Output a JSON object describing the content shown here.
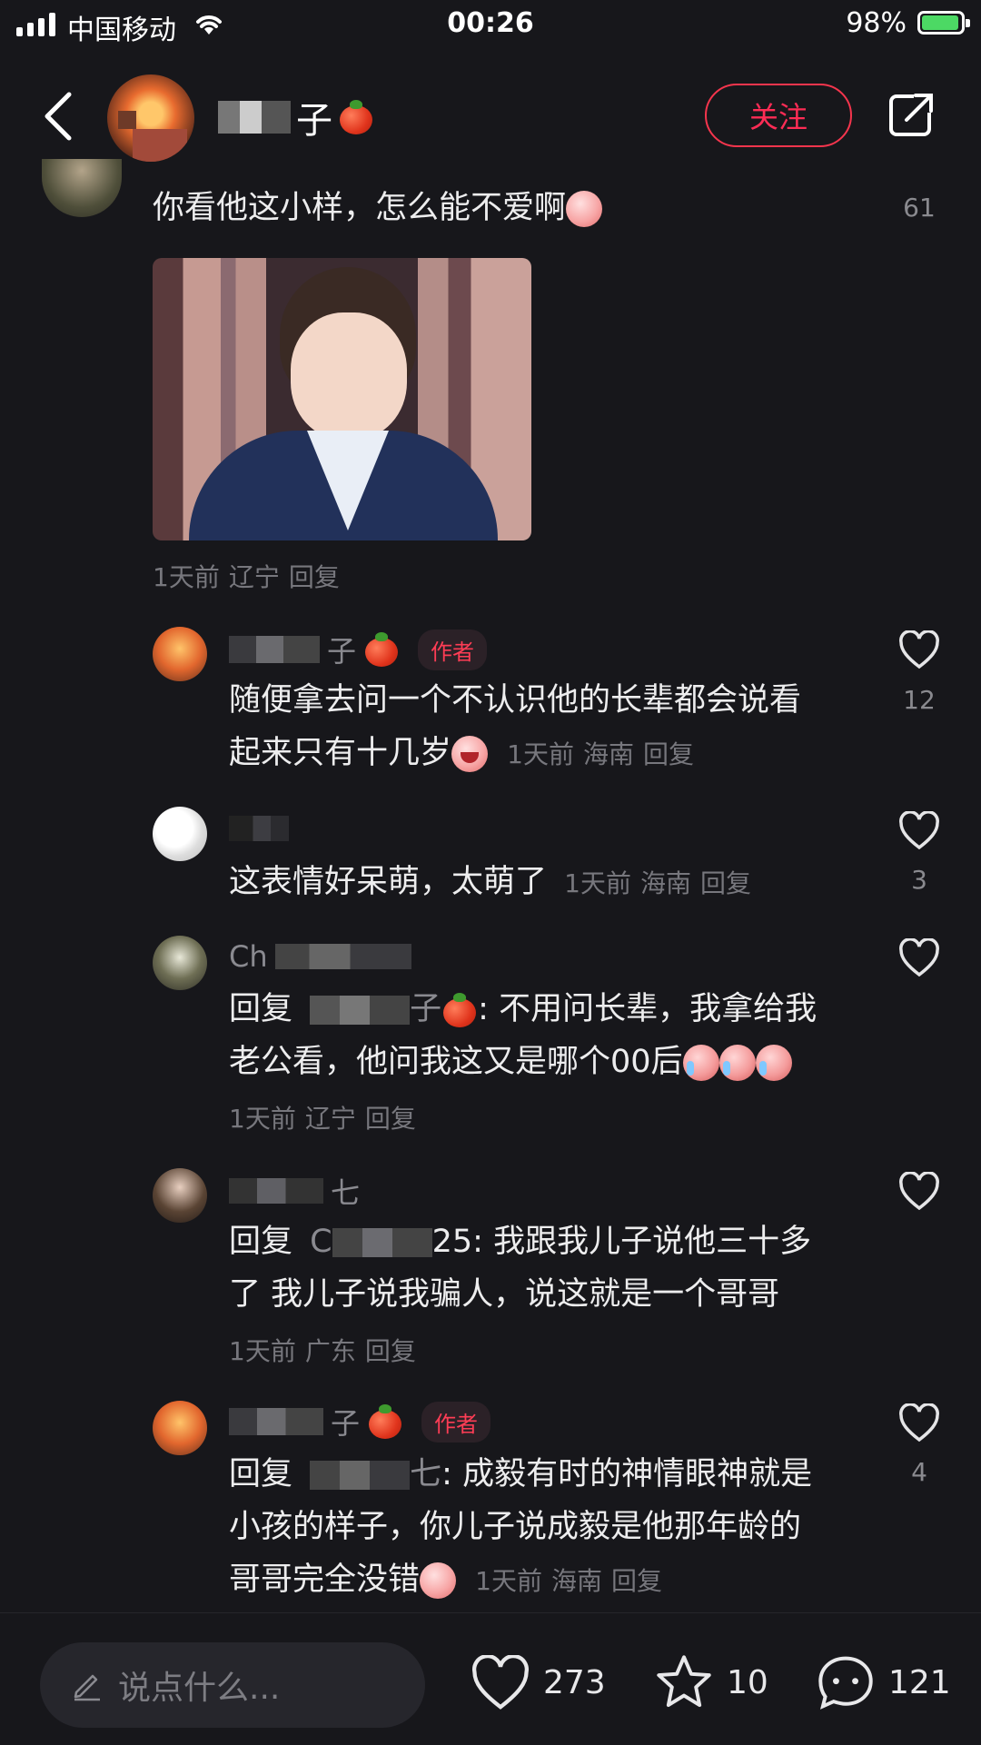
{
  "status": {
    "carrier": "中国移动",
    "time": "00:26",
    "battery": "98%"
  },
  "header": {
    "name_tail": "子",
    "follow": "关注"
  },
  "top_comment": {
    "text": "你看他这小样，怎么能不爱啊",
    "likes": "61",
    "time": "1天前",
    "region": "辽宁",
    "reply": "回复"
  },
  "replies": [
    {
      "name_tail": "子",
      "badge": "作者",
      "line1": "随便拿去问一个不认识他的长辈都会说看",
      "line2": "起来只有十几岁",
      "time": "1天前",
      "region": "海南",
      "reply": "回复",
      "likes": "12"
    },
    {
      "text": "这表情好呆萌，太萌了",
      "time": "1天前",
      "region": "海南",
      "reply": "回复",
      "likes": "3"
    },
    {
      "name_head": "Ch",
      "reply_prefix": "回复",
      "name_mid": "子",
      "line1_rest": ": 不用问长辈，我拿给我",
      "line2": "老公看，他问我这又是哪个00后",
      "time": "1天前",
      "region": "辽宁",
      "reply": "回复"
    },
    {
      "name_tail": "七",
      "reply_prefix": "回复",
      "reply_to_head": "C",
      "line1_rest": "25: 我跟我儿子说他三十多",
      "line2": "了 我儿子说我骗人，说这就是一个哥哥",
      "time": "1天前",
      "region": "广东",
      "reply": "回复"
    },
    {
      "name_tail": "子",
      "badge": "作者",
      "reply_prefix": "回复",
      "reply_to_tail": "七",
      "line1_rest": ": 成毅有时的神情眼神就是",
      "line2": "小孩的样子，你儿子说成毅是他那年龄的",
      "line3": "哥哥完全没错",
      "time": "1天前",
      "region": "海南",
      "reply": "回复",
      "likes": "4"
    }
  ],
  "bottom": {
    "placeholder": "说点什么...",
    "likes": "273",
    "favorites": "10",
    "comments": "121"
  },
  "colors": {
    "accent": "#fe2c55",
    "background": "#17171b"
  },
  "icons": [
    "back-icon",
    "share-icon",
    "heart-icon",
    "star-icon",
    "comment-icon",
    "pencil-icon",
    "tomato-emoji"
  ]
}
